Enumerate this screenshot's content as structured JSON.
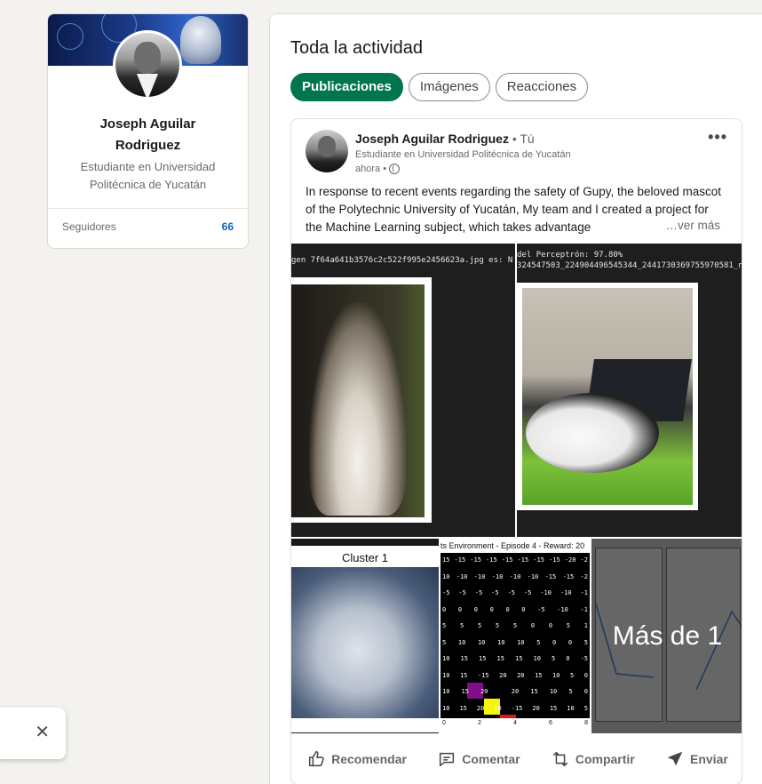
{
  "profile": {
    "name": "Joseph Aguilar Rodriguez",
    "headline": "Estudiante en Universidad Politécnica de Yucatán",
    "followers_label": "Seguidores",
    "followers_count": "66"
  },
  "activity": {
    "title": "Toda la actividad",
    "tabs": [
      {
        "label": "Publicaciones",
        "active": true
      },
      {
        "label": "Imágenes",
        "active": false
      },
      {
        "label": "Reacciones",
        "active": false
      }
    ]
  },
  "post": {
    "author": "Joseph Aguilar Rodriguez",
    "author_suffix": " • Tú",
    "subtitle": "Estudiante en Universidad Politécnica de Yucatán",
    "time": "ahora •",
    "text": "In response to recent events regarding the safety of Gupy, the beloved mascot of the Polytechnic University of Yucatán, My team and I created a project for the Machine Learning subject, which takes advantage",
    "see_more": "…ver más",
    "images": {
      "a_caption": "gen 7f64a641b3576c2c522f995e2456623a.jpg es: N",
      "b_caption_1": "del Perceptrón: 97.80%",
      "b_caption_2": "324547503_224904496545344_2441730369755970581_n.jp",
      "cluster_label": "Cluster 1",
      "grid_title": "ts Environment - Episode 4 - Reward: 20",
      "grid_rows": [
        [
          "15",
          "-15",
          "-15",
          "-15",
          "-15",
          "-15",
          "-15",
          "-15",
          "-20",
          "-2"
        ],
        [
          "10",
          "-10",
          "-10",
          "-10",
          "-10",
          "-10",
          "-15",
          "-15",
          "-2"
        ],
        [
          "-5",
          "-5",
          "-5",
          "-5",
          "-5",
          "-5",
          "-10",
          "-10",
          "-1"
        ],
        [
          "0",
          "0",
          "0",
          "0",
          "0",
          "0",
          "-5",
          "-10",
          "-1"
        ],
        [
          "5",
          "5",
          "5",
          "5",
          "5",
          "0",
          "0",
          "5",
          "1"
        ],
        [
          "5",
          "10",
          "10",
          "10",
          "10",
          "5",
          "0",
          "0",
          "5"
        ],
        [
          "10",
          "15",
          "15",
          "15",
          "15",
          "10",
          "5",
          "0",
          "-5"
        ],
        [
          "10",
          "15",
          "-15",
          "20",
          "20",
          "15",
          "10",
          "5",
          "0"
        ],
        [
          "10",
          "15",
          "20",
          "",
          "20",
          "15",
          "10",
          "5",
          "0"
        ],
        [
          "10",
          "15",
          "20",
          "20",
          "-15",
          "20",
          "15",
          "10",
          "5"
        ]
      ],
      "grid_axis": [
        "0",
        "2",
        "4",
        "6",
        "8"
      ],
      "more_overlay": "Más de 1"
    }
  },
  "actions": {
    "like": "Recomendar",
    "comment": "Comentar",
    "repost": "Compartir",
    "send": "Enviar"
  },
  "colors": {
    "active_tab": "#01754f",
    "link_blue": "#0a66c2"
  }
}
